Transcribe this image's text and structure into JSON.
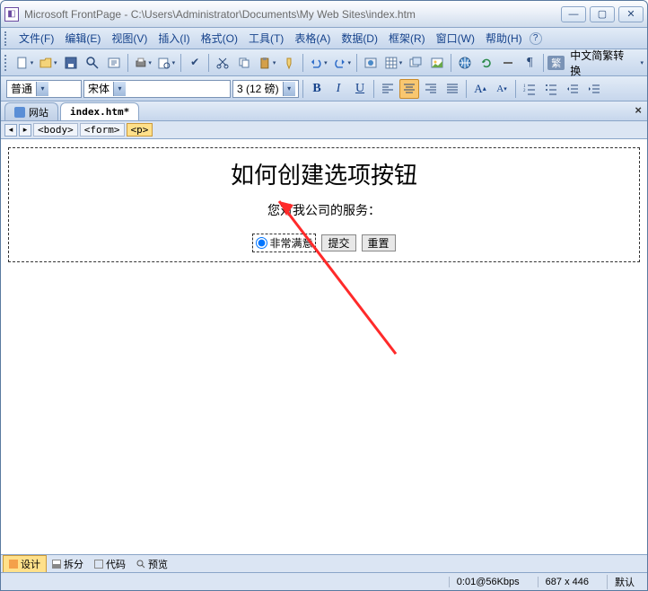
{
  "title": "Microsoft FrontPage - C:\\Users\\Administrator\\Documents\\My Web Sites\\index.htm",
  "menu": [
    "文件(F)",
    "编辑(E)",
    "视图(V)",
    "插入(I)",
    "格式(O)",
    "工具(T)",
    "表格(A)",
    "数据(D)",
    "框架(R)",
    "窗口(W)",
    "帮助(H)"
  ],
  "lang_toggle": "中文简繁转换",
  "style_combo": "普通",
  "font_combo": "宋体",
  "size_combo": "3 (12 磅)",
  "tabs": {
    "site": "网站",
    "file": "index.htm*"
  },
  "tags": [
    "<body>",
    "<form>",
    "<p>"
  ],
  "page": {
    "heading": "如何创建选项按钮",
    "subhead": "您对我公司的服务：",
    "radio_label": "非常满意",
    "submit": "提交",
    "reset": "重置"
  },
  "views": {
    "design": "设计",
    "split": "拆分",
    "code": "代码",
    "preview": "预览"
  },
  "status": {
    "speed": "0:01@56Kbps",
    "dims": "687 x 446",
    "mode": "默认"
  }
}
